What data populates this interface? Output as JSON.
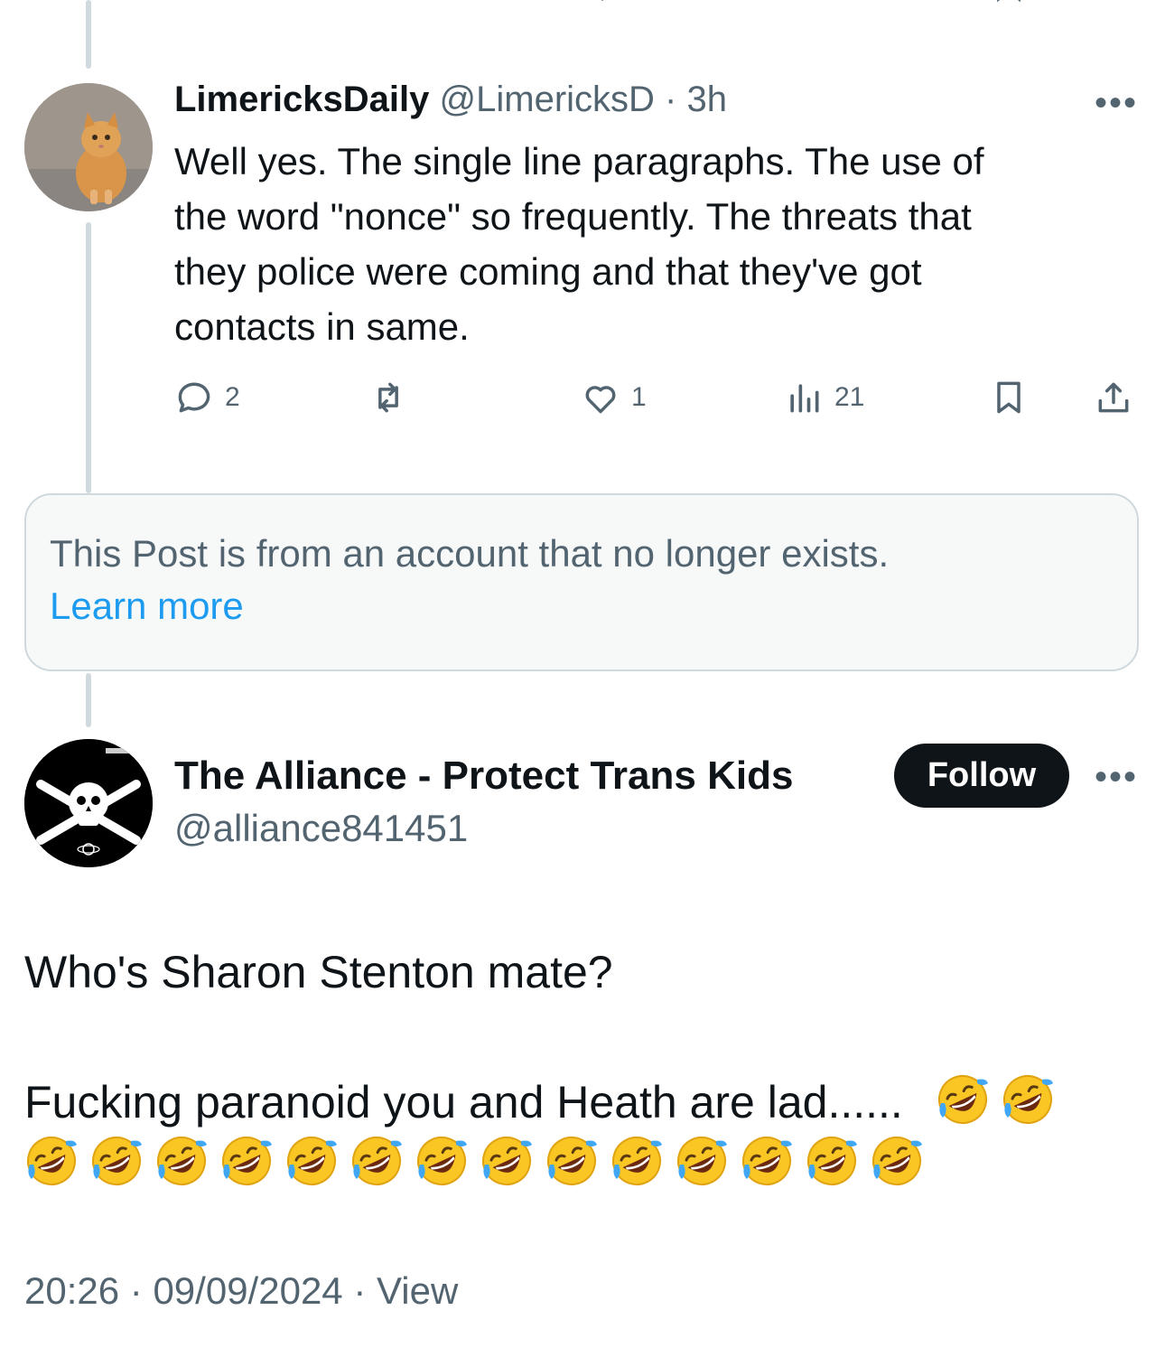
{
  "reply": {
    "display_name": "LimericksDaily",
    "handle": "@LimericksD",
    "separator": "·",
    "time": "3h",
    "more": "•••",
    "text": "Well yes. The single line paragraphs. The use of the word \"nonce\" so frequently. The threats that they police were coming and that they've got contacts in same.",
    "lines": [
      "Well yes. The single line paragraphs. The use of",
      "the word \"nonce\" so frequently. The threats that",
      "they police were coming and that they've got",
      "contacts in same."
    ],
    "actions": {
      "replies": "2",
      "reposts": "",
      "likes": "1",
      "views": "21"
    }
  },
  "notice": {
    "text": "This Post is from an account that no longer exists.",
    "link": "Learn more"
  },
  "main_post": {
    "display_name": "The Alliance - Protect Trans Kids",
    "handle": "@alliance841451",
    "follow_label": "Follow",
    "more": "•••",
    "line1": "Who's Sharon Stenton mate?",
    "line2": "Fucking paranoid you and Heath are lad......",
    "emoji_name": "rolling-on-the-floor-laughing",
    "emoji_count_line2": 2,
    "emoji_count_line3": 14,
    "time": "20:26",
    "date": "09/09/2024",
    "separator": "·",
    "view_label": "View"
  },
  "colors": {
    "text": "#0f1419",
    "muted": "#536471",
    "link": "#1d9bf0",
    "thread_line": "#cfd9de",
    "notice_bg": "#f7f9f9",
    "follow_bg": "#0f1419"
  }
}
